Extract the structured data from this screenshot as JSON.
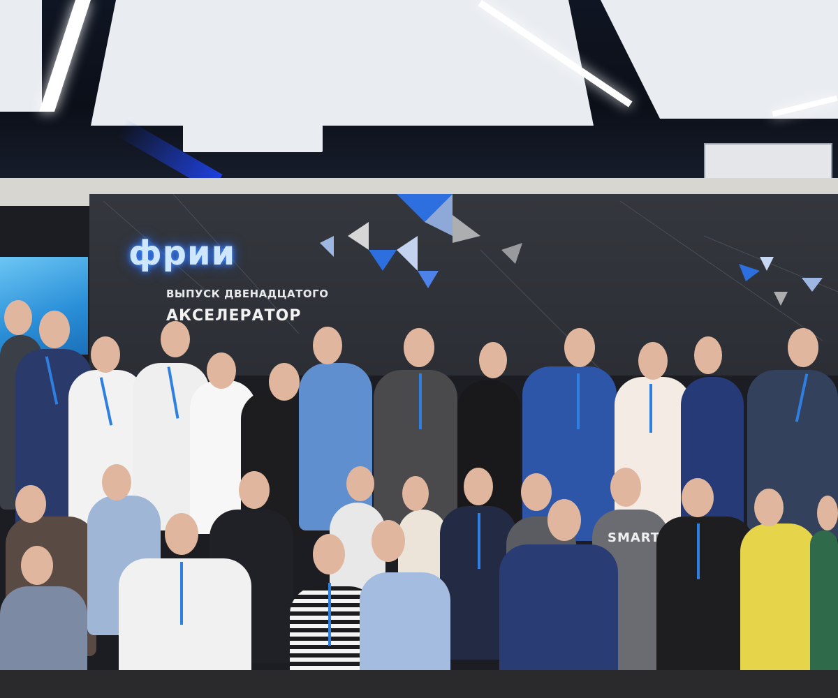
{
  "banner": {
    "logo_text": "фрии",
    "line1": "ВЫПУСК ДВЕНАДЦАТОГО",
    "line2": "АКСЕЛЕРАТОР"
  },
  "colors": {
    "logo_glow": "#3d8cff",
    "lanyard": "#2f7fe0",
    "stage_wall": "#2f3238",
    "accent_triangle": "#2e6fe0"
  },
  "shirt_print": "SMART"
}
